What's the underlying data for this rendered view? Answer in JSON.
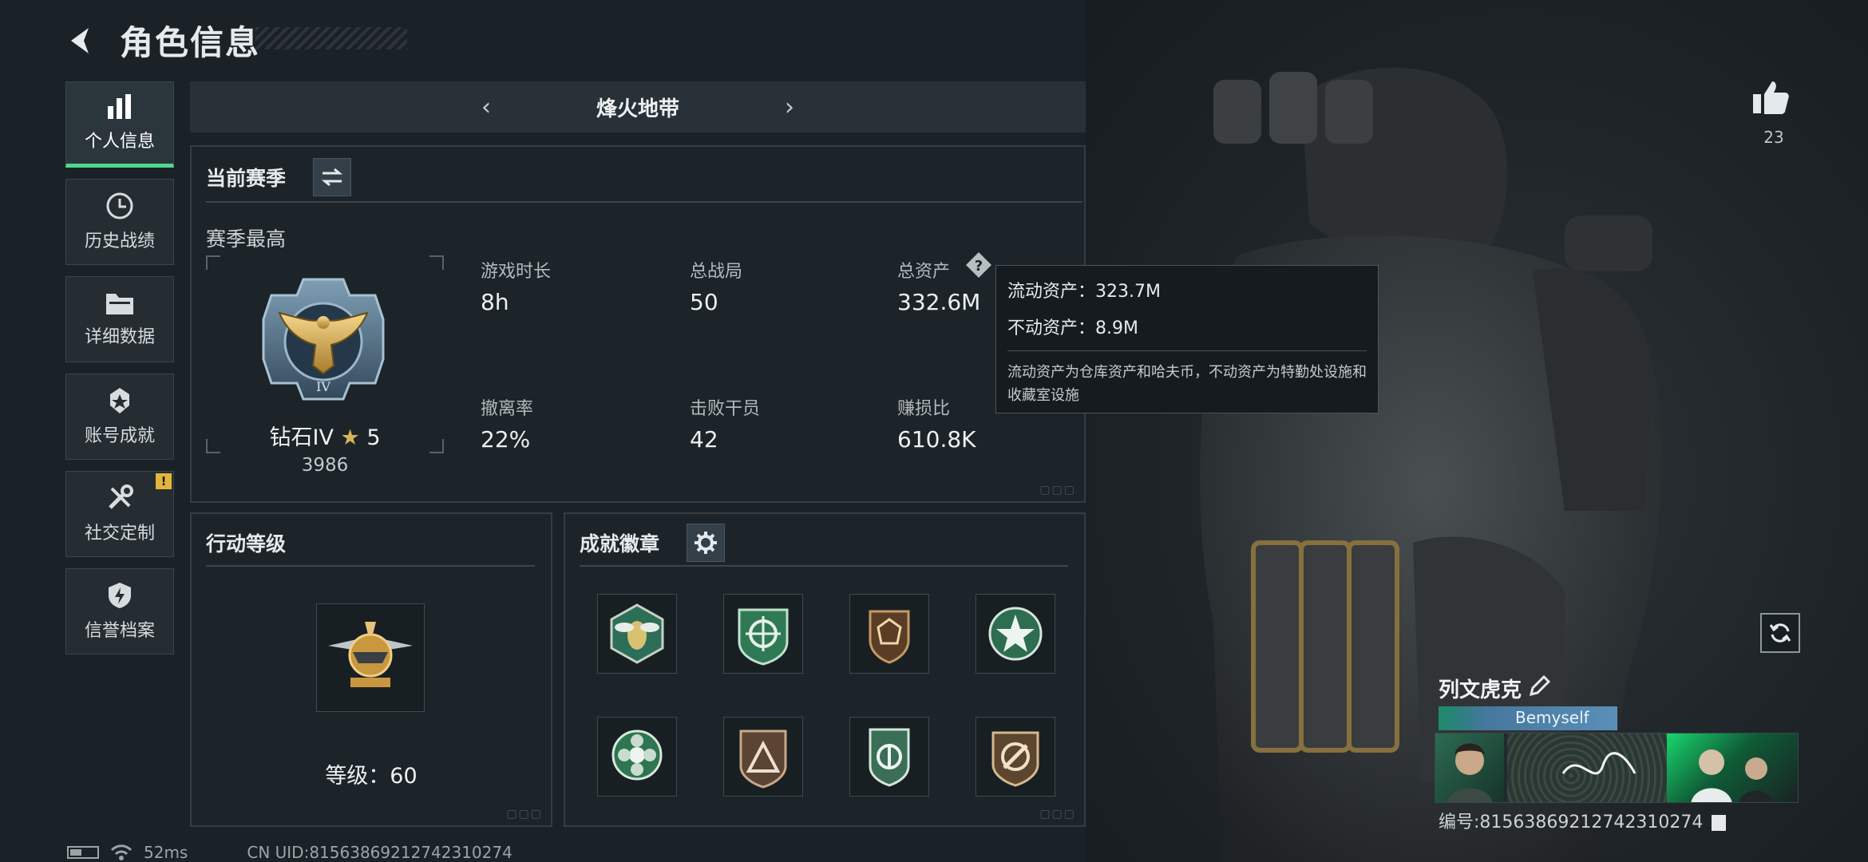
{
  "header": {
    "title": "角色信息"
  },
  "sidebar": {
    "items": [
      {
        "label": "个人信息",
        "icon": "bar-chart-icon",
        "active": true
      },
      {
        "label": "历史战绩",
        "icon": "clock-icon"
      },
      {
        "label": "详细数据",
        "icon": "folder-icon"
      },
      {
        "label": "账号成就",
        "icon": "medal-icon"
      },
      {
        "label": "社交定制",
        "icon": "tools-icon",
        "badge": "!"
      },
      {
        "label": "信誉档案",
        "icon": "shield-icon"
      }
    ]
  },
  "mode": {
    "name": "烽火地带",
    "prev_icon": "chevron-left-icon",
    "next_icon": "chevron-right-icon"
  },
  "season": {
    "title": "当前赛季",
    "subtitle": "赛季最高",
    "rank_name": "钻石IV",
    "rank_stars": "5",
    "rank_score": "3986",
    "stats": [
      {
        "label": "游戏时长",
        "value": "8h"
      },
      {
        "label": "总战局",
        "value": "50"
      },
      {
        "label": "总资产",
        "value": "332.6M"
      },
      {
        "label": "撤离率",
        "value": "22%"
      },
      {
        "label": "击败干员",
        "value": "42"
      },
      {
        "label": "赚损比",
        "value": "610.8K"
      }
    ],
    "help_icon": "?"
  },
  "tooltip": {
    "liquid": "流动资产：323.7M",
    "fixed": "不动资产：8.9M",
    "desc": "流动资产为仓库资产和哈夫币，不动资产为特勤处设施和收藏室设施"
  },
  "action_level": {
    "title": "行动等级",
    "level_text": "等级：60"
  },
  "achievements": {
    "title": "成就徽章",
    "count": 8
  },
  "profile": {
    "likes": "23",
    "player_name": "列文虎克",
    "team_name": "Bemyself",
    "id_text": "编号:81563869212742310274"
  },
  "status_bar": {
    "ping": "52ms",
    "uid": "CN UID:81563869212742310274"
  },
  "colors": {
    "accent": "#4fd98f",
    "warning": "#e3b53a",
    "panel_border": "#343d43"
  }
}
